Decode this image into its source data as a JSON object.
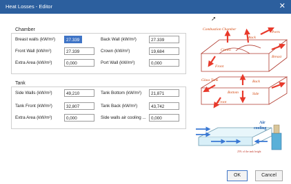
{
  "window": {
    "title": "Heat Losses - Editor",
    "close_glyph": "✕"
  },
  "chamber": {
    "label": "Chamber",
    "breast_walls": {
      "label": "Breast walls (kW/m²)",
      "value": "27.339"
    },
    "front_wall": {
      "label": "Front Wall (kW/m²)",
      "value": "27.339"
    },
    "extra_area": {
      "label": "Extra Area (kW/m²)",
      "value": "0,000"
    },
    "back_wall": {
      "label": "Back Wall (kW/m²)",
      "value": "27.339"
    },
    "crown": {
      "label": "Crown (kW/m²)",
      "value": "19,684"
    },
    "port_wall": {
      "label": "Port Wall (kW/m²)",
      "value": "0,000"
    }
  },
  "tank": {
    "label": "Tank",
    "side_walls": {
      "label": "Side Walls (kW/m²)",
      "value": "49,210"
    },
    "tank_front": {
      "label": "Tank Front (kW/m²)",
      "value": "32,807"
    },
    "extra_area": {
      "label": "Extra Area (kW/m²)",
      "value": "0,000"
    },
    "tank_bottom": {
      "label": "Tank Bottom (kW/m²)",
      "value": "21,871"
    },
    "tank_back": {
      "label": "Tank Back (kW/m²)",
      "value": "43,742"
    },
    "side_walls_air": {
      "label": "Side walls air cooling ...",
      "value": "0,000"
    }
  },
  "diagram_chamber": {
    "combustion_chamber": "Combustion Chamber",
    "crown": "Crown",
    "back": "Back",
    "ports": "Ports",
    "breast": "Breast",
    "front": "Front"
  },
  "diagram_tank": {
    "glass_tank": "Glass Tank",
    "back": "Back",
    "bottom": "Bottom",
    "side": "Side",
    "front": "Front"
  },
  "diagram_cooling": {
    "air": "Air",
    "cooling": "cooling",
    "note": "25% of the tank height"
  },
  "buttons": {
    "ok": "OK",
    "cancel": "Cancel"
  },
  "colors": {
    "titlebar": "#2c5f9e",
    "diagram_lines": "#c0392b",
    "arrows": "#e8392b",
    "cooling_arrows": "#3a78d4",
    "selection": "#3f74c6"
  }
}
